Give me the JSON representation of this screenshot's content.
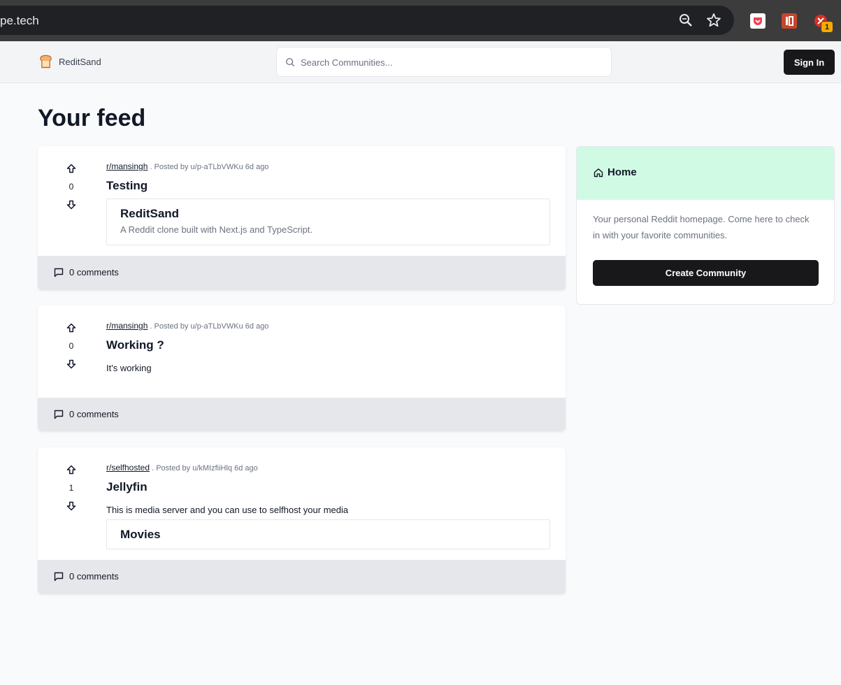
{
  "browser": {
    "url": "pe.tech",
    "extension_badge": "1"
  },
  "header": {
    "brand": "ReditSand",
    "search_placeholder": "Search Communities...",
    "signin_label": "Sign In"
  },
  "page": {
    "title": "Your feed"
  },
  "posts": [
    {
      "subreddit": "r/mansingh",
      "meta": ". Posted by u/p-aTLbVWKu 6d ago",
      "score": "0",
      "title": "Testing",
      "body": "",
      "embed": {
        "title": "ReditSand",
        "description": "A Reddit clone built with Next.js and TypeScript."
      },
      "comments": "0 comments"
    },
    {
      "subreddit": "r/mansingh",
      "meta": ". Posted by u/p-aTLbVWKu 6d ago",
      "score": "0",
      "title": "Working ?",
      "body": "It's working",
      "comments": "0 comments"
    },
    {
      "subreddit": "r/selfhosted",
      "meta": ". Posted by u/kMIzfiiHlq 6d ago",
      "score": "1",
      "title": "Jellyfin",
      "body": "This is media server and you can use to selfhost your media",
      "embed": {
        "title": "Movies"
      },
      "comments": "0 comments"
    }
  ],
  "sidebar": {
    "heading": "Home",
    "description": "Your personal Reddit homepage. Come here to check in with your favorite communities.",
    "button_label": "Create Community"
  },
  "colors": {
    "accent_green": "#d1fae5",
    "button_dark": "#18181b",
    "footer_gray": "#e5e7eb"
  }
}
